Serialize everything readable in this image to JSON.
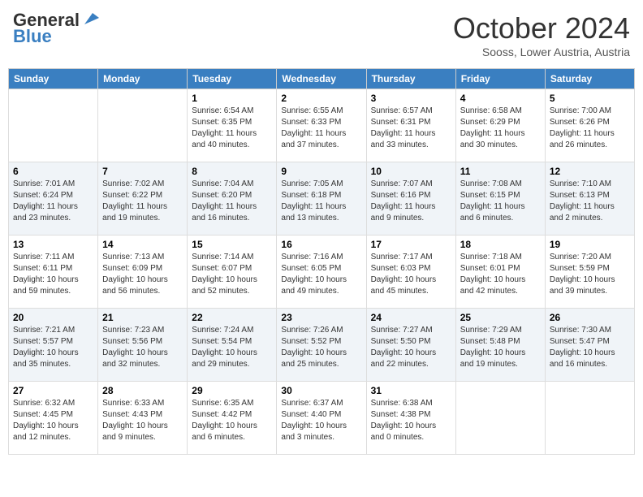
{
  "header": {
    "logo_line1": "General",
    "logo_line2": "Blue",
    "month_title": "October 2024",
    "subtitle": "Sooss, Lower Austria, Austria"
  },
  "weekdays": [
    "Sunday",
    "Monday",
    "Tuesday",
    "Wednesday",
    "Thursday",
    "Friday",
    "Saturday"
  ],
  "weeks": [
    [
      {
        "day": "",
        "sunrise": "",
        "sunset": "",
        "daylight": ""
      },
      {
        "day": "",
        "sunrise": "",
        "sunset": "",
        "daylight": ""
      },
      {
        "day": "1",
        "sunrise": "Sunrise: 6:54 AM",
        "sunset": "Sunset: 6:35 PM",
        "daylight": "Daylight: 11 hours and 40 minutes."
      },
      {
        "day": "2",
        "sunrise": "Sunrise: 6:55 AM",
        "sunset": "Sunset: 6:33 PM",
        "daylight": "Daylight: 11 hours and 37 minutes."
      },
      {
        "day": "3",
        "sunrise": "Sunrise: 6:57 AM",
        "sunset": "Sunset: 6:31 PM",
        "daylight": "Daylight: 11 hours and 33 minutes."
      },
      {
        "day": "4",
        "sunrise": "Sunrise: 6:58 AM",
        "sunset": "Sunset: 6:29 PM",
        "daylight": "Daylight: 11 hours and 30 minutes."
      },
      {
        "day": "5",
        "sunrise": "Sunrise: 7:00 AM",
        "sunset": "Sunset: 6:26 PM",
        "daylight": "Daylight: 11 hours and 26 minutes."
      }
    ],
    [
      {
        "day": "6",
        "sunrise": "Sunrise: 7:01 AM",
        "sunset": "Sunset: 6:24 PM",
        "daylight": "Daylight: 11 hours and 23 minutes."
      },
      {
        "day": "7",
        "sunrise": "Sunrise: 7:02 AM",
        "sunset": "Sunset: 6:22 PM",
        "daylight": "Daylight: 11 hours and 19 minutes."
      },
      {
        "day": "8",
        "sunrise": "Sunrise: 7:04 AM",
        "sunset": "Sunset: 6:20 PM",
        "daylight": "Daylight: 11 hours and 16 minutes."
      },
      {
        "day": "9",
        "sunrise": "Sunrise: 7:05 AM",
        "sunset": "Sunset: 6:18 PM",
        "daylight": "Daylight: 11 hours and 13 minutes."
      },
      {
        "day": "10",
        "sunrise": "Sunrise: 7:07 AM",
        "sunset": "Sunset: 6:16 PM",
        "daylight": "Daylight: 11 hours and 9 minutes."
      },
      {
        "day": "11",
        "sunrise": "Sunrise: 7:08 AM",
        "sunset": "Sunset: 6:15 PM",
        "daylight": "Daylight: 11 hours and 6 minutes."
      },
      {
        "day": "12",
        "sunrise": "Sunrise: 7:10 AM",
        "sunset": "Sunset: 6:13 PM",
        "daylight": "Daylight: 11 hours and 2 minutes."
      }
    ],
    [
      {
        "day": "13",
        "sunrise": "Sunrise: 7:11 AM",
        "sunset": "Sunset: 6:11 PM",
        "daylight": "Daylight: 10 hours and 59 minutes."
      },
      {
        "day": "14",
        "sunrise": "Sunrise: 7:13 AM",
        "sunset": "Sunset: 6:09 PM",
        "daylight": "Daylight: 10 hours and 56 minutes."
      },
      {
        "day": "15",
        "sunrise": "Sunrise: 7:14 AM",
        "sunset": "Sunset: 6:07 PM",
        "daylight": "Daylight: 10 hours and 52 minutes."
      },
      {
        "day": "16",
        "sunrise": "Sunrise: 7:16 AM",
        "sunset": "Sunset: 6:05 PM",
        "daylight": "Daylight: 10 hours and 49 minutes."
      },
      {
        "day": "17",
        "sunrise": "Sunrise: 7:17 AM",
        "sunset": "Sunset: 6:03 PM",
        "daylight": "Daylight: 10 hours and 45 minutes."
      },
      {
        "day": "18",
        "sunrise": "Sunrise: 7:18 AM",
        "sunset": "Sunset: 6:01 PM",
        "daylight": "Daylight: 10 hours and 42 minutes."
      },
      {
        "day": "19",
        "sunrise": "Sunrise: 7:20 AM",
        "sunset": "Sunset: 5:59 PM",
        "daylight": "Daylight: 10 hours and 39 minutes."
      }
    ],
    [
      {
        "day": "20",
        "sunrise": "Sunrise: 7:21 AM",
        "sunset": "Sunset: 5:57 PM",
        "daylight": "Daylight: 10 hours and 35 minutes."
      },
      {
        "day": "21",
        "sunrise": "Sunrise: 7:23 AM",
        "sunset": "Sunset: 5:56 PM",
        "daylight": "Daylight: 10 hours and 32 minutes."
      },
      {
        "day": "22",
        "sunrise": "Sunrise: 7:24 AM",
        "sunset": "Sunset: 5:54 PM",
        "daylight": "Daylight: 10 hours and 29 minutes."
      },
      {
        "day": "23",
        "sunrise": "Sunrise: 7:26 AM",
        "sunset": "Sunset: 5:52 PM",
        "daylight": "Daylight: 10 hours and 25 minutes."
      },
      {
        "day": "24",
        "sunrise": "Sunrise: 7:27 AM",
        "sunset": "Sunset: 5:50 PM",
        "daylight": "Daylight: 10 hours and 22 minutes."
      },
      {
        "day": "25",
        "sunrise": "Sunrise: 7:29 AM",
        "sunset": "Sunset: 5:48 PM",
        "daylight": "Daylight: 10 hours and 19 minutes."
      },
      {
        "day": "26",
        "sunrise": "Sunrise: 7:30 AM",
        "sunset": "Sunset: 5:47 PM",
        "daylight": "Daylight: 10 hours and 16 minutes."
      }
    ],
    [
      {
        "day": "27",
        "sunrise": "Sunrise: 6:32 AM",
        "sunset": "Sunset: 4:45 PM",
        "daylight": "Daylight: 10 hours and 12 minutes."
      },
      {
        "day": "28",
        "sunrise": "Sunrise: 6:33 AM",
        "sunset": "Sunset: 4:43 PM",
        "daylight": "Daylight: 10 hours and 9 minutes."
      },
      {
        "day": "29",
        "sunrise": "Sunrise: 6:35 AM",
        "sunset": "Sunset: 4:42 PM",
        "daylight": "Daylight: 10 hours and 6 minutes."
      },
      {
        "day": "30",
        "sunrise": "Sunrise: 6:37 AM",
        "sunset": "Sunset: 4:40 PM",
        "daylight": "Daylight: 10 hours and 3 minutes."
      },
      {
        "day": "31",
        "sunrise": "Sunrise: 6:38 AM",
        "sunset": "Sunset: 4:38 PM",
        "daylight": "Daylight: 10 hours and 0 minutes."
      },
      {
        "day": "",
        "sunrise": "",
        "sunset": "",
        "daylight": ""
      },
      {
        "day": "",
        "sunrise": "",
        "sunset": "",
        "daylight": ""
      }
    ]
  ]
}
